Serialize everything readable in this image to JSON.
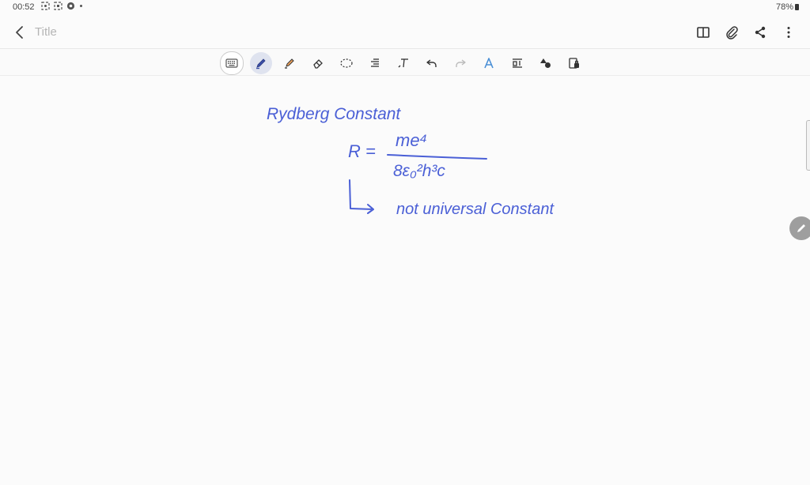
{
  "status": {
    "time": "00:52",
    "battery": "78%",
    "icons": [
      "screen-record-icon",
      "screen-capture-icon",
      "chrome-icon",
      "dot-icon"
    ]
  },
  "header": {
    "title_placeholder": "Title",
    "actions": [
      "book-view-icon",
      "attach-icon",
      "share-icon",
      "more-icon"
    ]
  },
  "toolbar": {
    "tools": [
      "keyboard-icon",
      "pen-icon",
      "highlighter-icon",
      "eraser-icon",
      "lasso-icon",
      "text-align-icon",
      "text-insert-icon",
      "undo-icon",
      "redo-icon",
      "text-style-icon",
      "text-box-icon",
      "shapes-icon",
      "lock-icon"
    ],
    "active_tool": "pen-icon"
  },
  "note": {
    "ink_color": "#4a5fd6",
    "heading": "Rydberg Constant",
    "formula_lhs": "R =",
    "formula_numerator": "me⁴",
    "formula_denominator": "8ε₀²h³c",
    "remark": "not universal Constant"
  }
}
